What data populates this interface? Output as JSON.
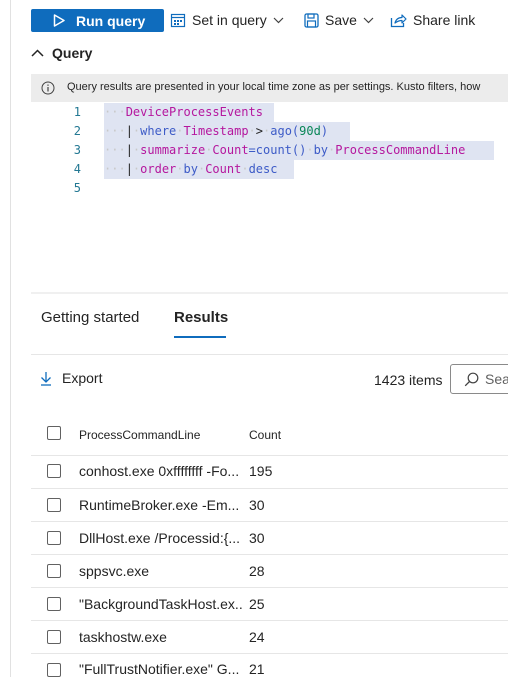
{
  "toolbar": {
    "run_query": "Run query",
    "set_in_query": "Set in query",
    "save": "Save",
    "share_link": "Share link"
  },
  "query": {
    "header": "Query",
    "info": "Query results are presented in your local time zone as per settings. Kusto filters, how",
    "lines": [
      {
        "n": "1"
      },
      {
        "n": "2"
      },
      {
        "n": "3"
      },
      {
        "n": "4"
      },
      {
        "n": "5"
      }
    ],
    "code": {
      "l1_table": "DeviceProcessEvents",
      "l2_pipe": "|",
      "l2_where": "where",
      "l2_field": "Timestamp",
      "l2_op": ">",
      "l2_func": "ago(",
      "l2_num": "90d",
      "l2_close": ")",
      "l3_pipe": "|",
      "l3_summarize": "summarize",
      "l3_count": "Count",
      "l3_eq": "=count()",
      "l3_by": "by",
      "l3_field": "ProcessCommandLine",
      "l4_pipe": "|",
      "l4_order": "order",
      "l4_by": "by",
      "l4_count": "Count",
      "l4_desc": "desc"
    }
  },
  "tabs": {
    "getting_started": "Getting started",
    "results": "Results"
  },
  "results": {
    "export": "Export",
    "items_count": "1423 items",
    "search_placeholder": "Sea",
    "columns": {
      "col1": "ProcessCommandLine",
      "col2": "Count"
    },
    "rows": [
      {
        "cmd": "conhost.exe 0xffffffff -Fo...",
        "count": "195"
      },
      {
        "cmd": "RuntimeBroker.exe -Em...",
        "count": "30"
      },
      {
        "cmd": "DllHost.exe /Processid:{...",
        "count": "30"
      },
      {
        "cmd": "sppsvc.exe",
        "count": "28"
      },
      {
        "cmd": "\"BackgroundTaskHost.ex...",
        "count": "25"
      },
      {
        "cmd": "taskhostw.exe",
        "count": "24"
      },
      {
        "cmd": "\"FullTrustNotifier.exe\" G...",
        "count": "21"
      }
    ]
  },
  "colors": {
    "accent": "#0f6cbd",
    "selection": "#dfe4f2"
  }
}
